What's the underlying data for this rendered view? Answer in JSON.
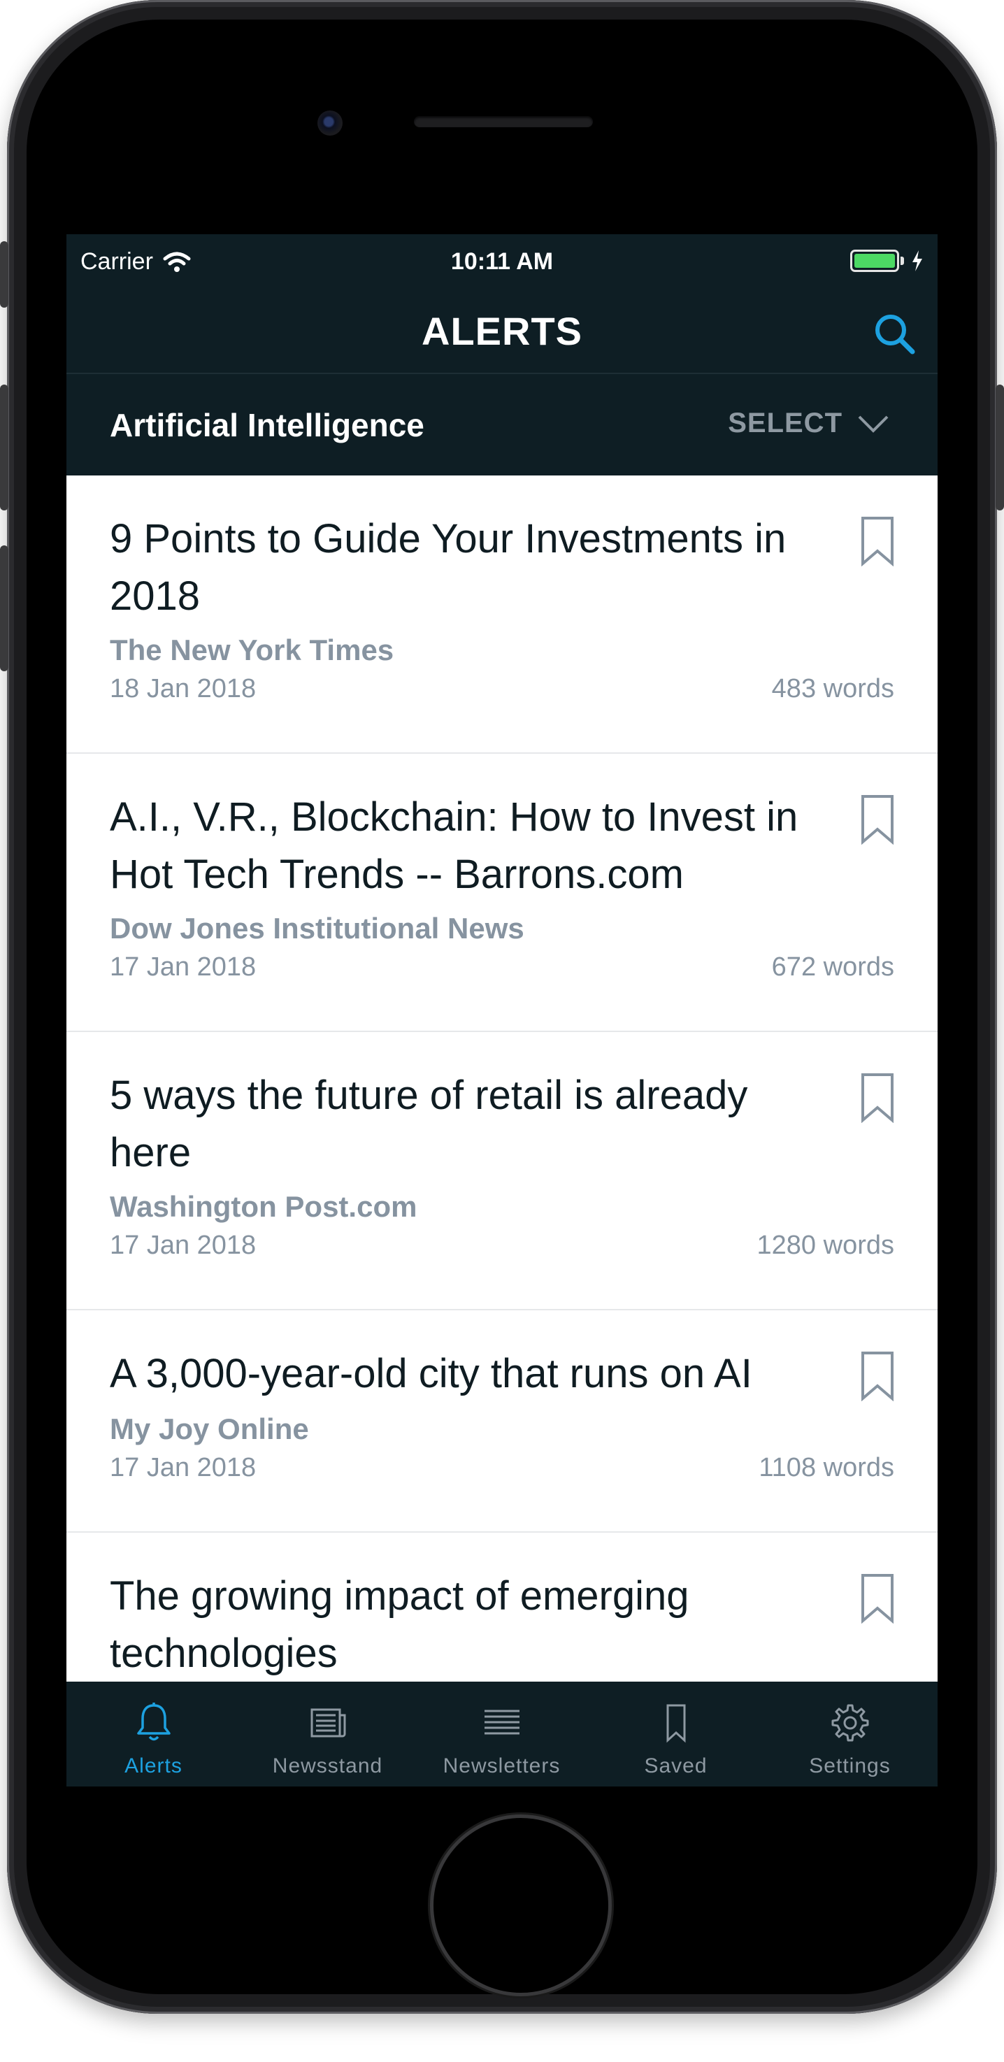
{
  "status_bar": {
    "carrier": "Carrier",
    "time": "10:11 AM"
  },
  "header": {
    "title": "ALERTS"
  },
  "filter": {
    "topic": "Artificial Intelligence",
    "select_label": "SELECT"
  },
  "articles": [
    {
      "title": "9 Points to Guide Your Investments in 2018",
      "source": "The New York Times",
      "date": "18 Jan 2018",
      "words": "483 words"
    },
    {
      "title": "A.I., V.R., Blockchain: How to Invest in Hot Tech Trends -- Barrons.com",
      "source": "Dow Jones Institutional News",
      "date": "17 Jan 2018",
      "words": "672 words"
    },
    {
      "title": "5 ways the future of retail is already here",
      "source": "Washington Post.com",
      "date": "17 Jan 2018",
      "words": "1280 words"
    },
    {
      "title": "A 3,000-year-old city that runs on AI",
      "source": "My Joy Online",
      "date": "17 Jan 2018",
      "words": "1108 words"
    },
    {
      "title": "The growing impact of emerging technologies",
      "source": "",
      "date": "",
      "words": ""
    }
  ],
  "tabs": [
    {
      "label": "Alerts",
      "icon": "bell-icon",
      "active": true
    },
    {
      "label": "Newsstand",
      "icon": "newspaper-icon",
      "active": false
    },
    {
      "label": "Newsletters",
      "icon": "lines-icon",
      "active": false
    },
    {
      "label": "Saved",
      "icon": "bookmark-icon",
      "active": false
    },
    {
      "label": "Settings",
      "icon": "gear-icon",
      "active": false
    }
  ],
  "colors": {
    "accent": "#1da1e0",
    "bar_background": "#0e1e24",
    "meta_text": "#8693a0",
    "battery": "#4cd964"
  }
}
